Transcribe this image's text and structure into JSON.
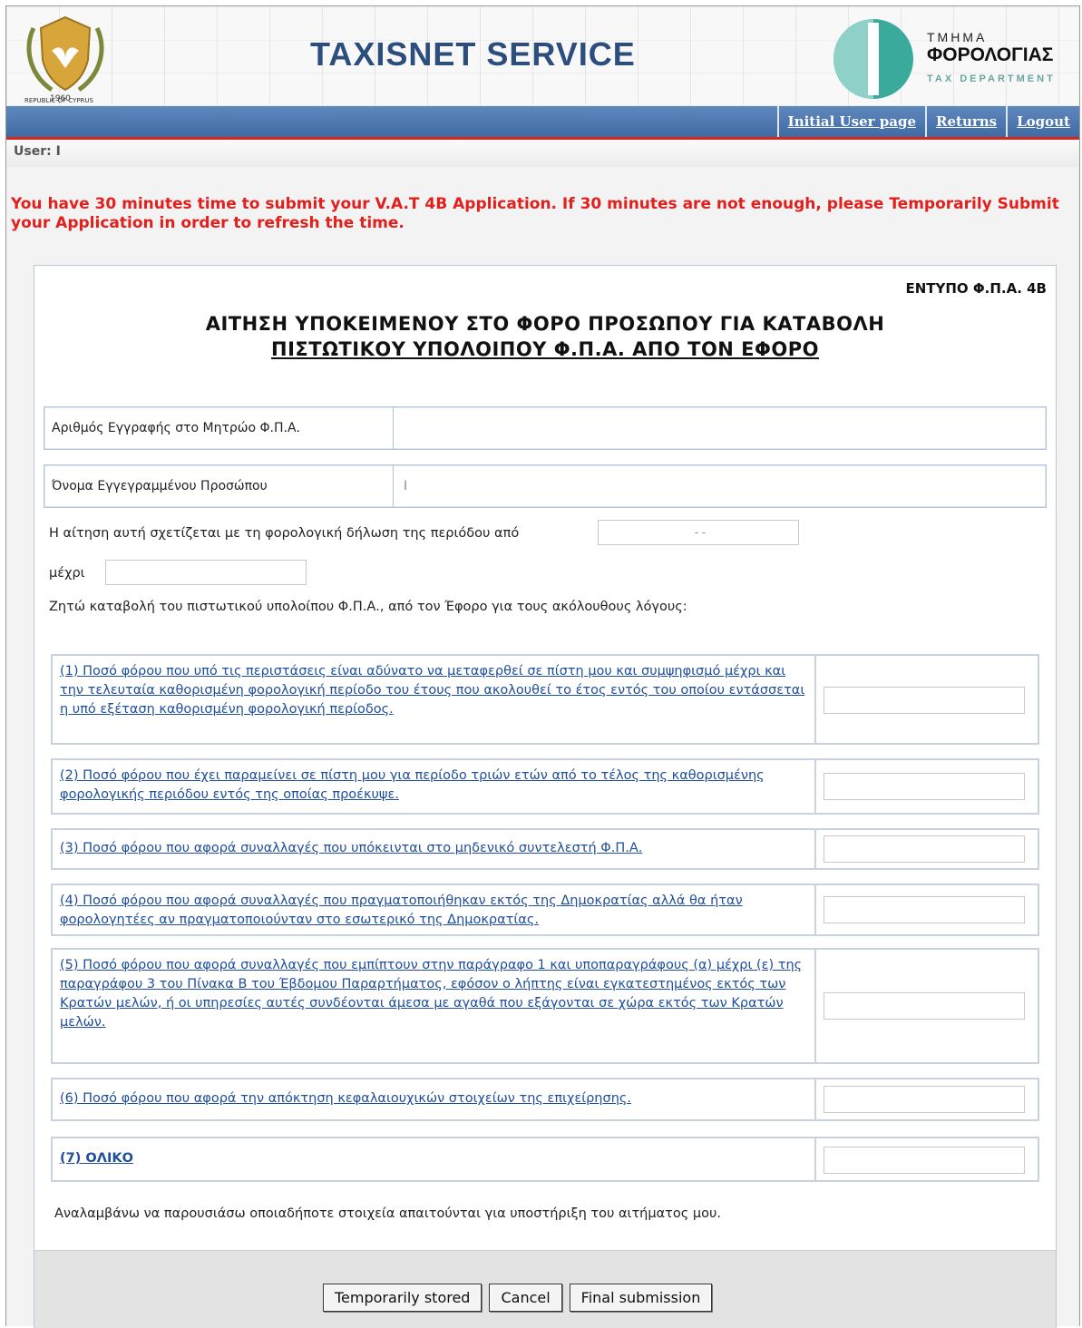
{
  "header": {
    "crest_caption": "REPUBLIC OF CYPRUS",
    "title": "TAXISNET SERVICE",
    "dept_line1": "ΤΜΗΜΑ",
    "dept_line2": "ΦΟΡΟΛΟΓΙΑΣ",
    "dept_line3": "TAX DEPARTMENT",
    "brand_color": "#2c4e7e",
    "logo_color": "#3aaa9c"
  },
  "nav": {
    "links": [
      "Initial User page",
      "Returns",
      "Logout"
    ]
  },
  "user": {
    "label": "User: I"
  },
  "warning": "You have 30 minutes time to submit your V.A.T 4B Application. If 30 minutes are not enough, please Temporarily Submit your Application in order to refresh the time.",
  "form": {
    "code": "ΕΝΤΥΠΟ Φ.Π.Α. 4Β",
    "title_line1": "ΑΙΤΗΣΗ ΥΠΟΚΕΙΜΕΝΟΥ ΣΤΟ ΦΟΡΟ ΠΡΟΣΩΠΟΥ ΓΙΑ ΚΑΤΑΒΟΛΗ",
    "title_line2": "ΠΙΣΤΩΤΙΚΟΥ ΥΠΟΛΟΙΠΟΥ Φ.Π.Α. ΑΠΟ ΤΟΝ ΕΦΟΡΟ",
    "reg_label": "Αριθμός Εγγραφής στο Μητρώο Φ.Π.Α.",
    "reg_value": "",
    "name_label": "Όνομα Εγγεγραμμένου Προσώπου",
    "name_value": "I",
    "period_text": "Η αίτηση αυτή σχετίζεται με τη φορολογική δήλωση της περιόδου από",
    "period_from": "- -",
    "until_label": "μέχρι",
    "until_value": "",
    "request_text": "Ζητώ καταβολή του πιστωτικού υπολοίπου Φ.Π.Α., από τον Έφορο για τους ακόλουθους λόγους:",
    "reasons": [
      "(1) Ποσό φόρου που υπό τις περιστάσεις είναι αδύνατο να μεταφερθεί σε πίστη μου και συμψηφισμό μέχρι και την τελευταία καθορισμένη φορολογική περίοδο του έτους που ακολουθεί το έτος εντός του οποίου εντάσσεται η υπό εξέταση καθορισμένη φορολογική περίοδος.",
      "(2) Ποσό φόρου που έχει παραμείνει σε πίστη μου για περίοδο τριών ετών από το τέλος της καθορισμένης φορολογικής περιόδου εντός της οποίας προέκυψε.",
      "(3) Ποσό φόρου που αφορά συναλλαγές που υπόκεινται στο μηδενικό συντελεστή Φ.Π.Α.",
      "(4) Ποσό φόρου που αφορά συναλλαγές που πραγματοποιήθηκαν εκτός της Δημοκρατίας αλλά θα ήταν φορολογητέες αν πραγματοποιούνταν στο εσωτερικό της Δημοκρατίας.",
      "(5) Ποσό φόρου που αφορά συναλλαγές που εμπίπτουν στην παράγραφο 1 και υποπαραγράφους (α) μέχρι (ε) της παραγράφου 3 του Πίνακα Β του Έβδομου Παραρτήματος, εφόσον ο λήπτης είναι εγκατεστημένος εκτός των Κρατών μελών, ή οι υπηρεσίες αυτές συνδέονται άμεσα με αγαθά που εξάγονται σε χώρα εκτός των Κρατών μελών.",
      "(6) Ποσό φόρου που αφορά την απόκτηση κεφαλαιουχικών στοιχείων της επιχείρησης."
    ],
    "total_label": "(7) ΟΛΙΚΟ",
    "declaration": "Αναλαμβάνω να παρουσιάσω οποιαδήποτε στοιχεία απαιτούνται για υποστήριξη του αιτήματος μου."
  },
  "buttons": {
    "temp": "Temporarily stored",
    "cancel": "Cancel",
    "final": "Final submission"
  }
}
